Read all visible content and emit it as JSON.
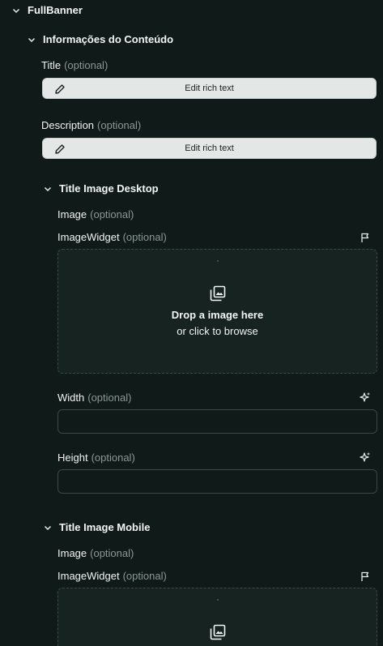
{
  "root": {
    "title": "FullBanner"
  },
  "content_section": {
    "title": "Informações do Conteúdo",
    "title_field": {
      "label": "Title",
      "optional": "(optional)",
      "button": "Edit rich text"
    },
    "description_field": {
      "label": "Description",
      "optional": "(optional)",
      "button": "Edit rich text"
    }
  },
  "desktop_section": {
    "title": "Title Image Desktop",
    "image_label": "Image",
    "image_optional": "(optional)",
    "widget_label": "ImageWidget",
    "widget_optional": "(optional)",
    "drop_title": "Drop a image here",
    "drop_sub": "or click to browse",
    "width_label": "Width",
    "width_optional": "(optional)",
    "width_value": "",
    "height_label": "Height",
    "height_optional": "(optional)",
    "height_value": ""
  },
  "mobile_section": {
    "title": "Title Image Mobile",
    "image_label": "Image",
    "image_optional": "(optional)",
    "widget_label": "ImageWidget",
    "widget_optional": "(optional)"
  },
  "icons": {
    "chevron": "chevron-down-icon",
    "pencil": "pencil-icon",
    "flag": "flag-icon",
    "gallery": "image-gallery-icon",
    "sparkle": "sparkle-icon"
  }
}
